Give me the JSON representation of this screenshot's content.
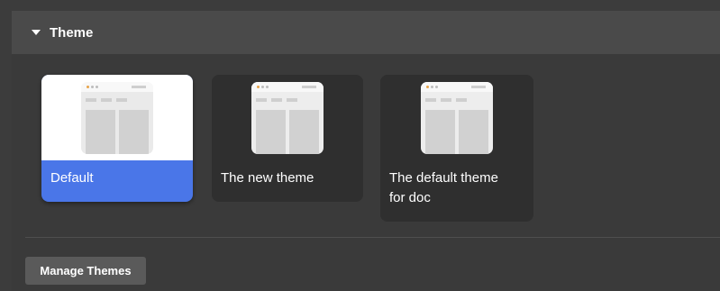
{
  "section": {
    "title": "Theme",
    "expanded": true
  },
  "themes": [
    {
      "name": "Default",
      "selected": true
    },
    {
      "name": "The new theme",
      "selected": false
    },
    {
      "name": "The default theme for doc",
      "selected": false
    }
  ],
  "actions": {
    "manage_label": "Manage Themes"
  },
  "colors": {
    "selected_accent": "#4a76e8",
    "card_bg": "#2f2f2f",
    "header_bg": "#4a4a4a",
    "panel_bg": "#3a3a3a"
  }
}
